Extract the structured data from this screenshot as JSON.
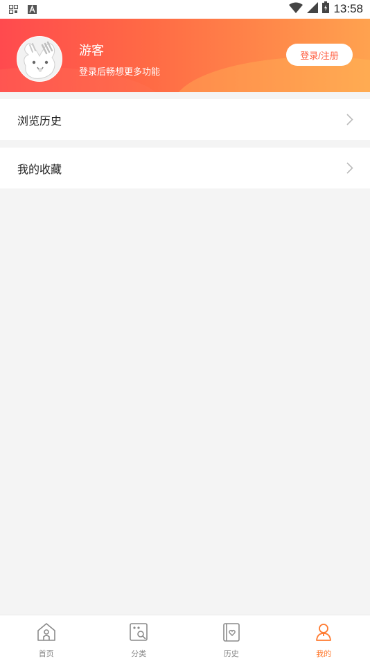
{
  "status_bar": {
    "time": "13:58",
    "left_icons": [
      "qr-code-icon",
      "app-notification-icon"
    ],
    "right_icons": [
      "wifi-icon",
      "signal-icon",
      "battery-icon"
    ]
  },
  "profile": {
    "username": "游客",
    "subtitle": "登录后畅想更多功能",
    "login_button": "登录/注册",
    "avatar_icon": "bunny-avatar-icon"
  },
  "menu": {
    "items": [
      {
        "label": "浏览历史",
        "icon": "chevron-right-icon"
      },
      {
        "label": "我的收藏",
        "icon": "chevron-right-icon"
      }
    ]
  },
  "tabbar": {
    "tabs": [
      {
        "label": "首页",
        "icon": "home-icon",
        "active": false
      },
      {
        "label": "分类",
        "icon": "category-search-icon",
        "active": false
      },
      {
        "label": "历史",
        "icon": "history-book-icon",
        "active": false
      },
      {
        "label": "我的",
        "icon": "user-icon",
        "active": true
      }
    ]
  },
  "colors": {
    "header_gradient_start": "#ff4a4e",
    "header_gradient_end": "#ffa24f",
    "accent": "#ff7a2f",
    "login_text": "#ff5a3c",
    "background": "#f4f4f4"
  }
}
